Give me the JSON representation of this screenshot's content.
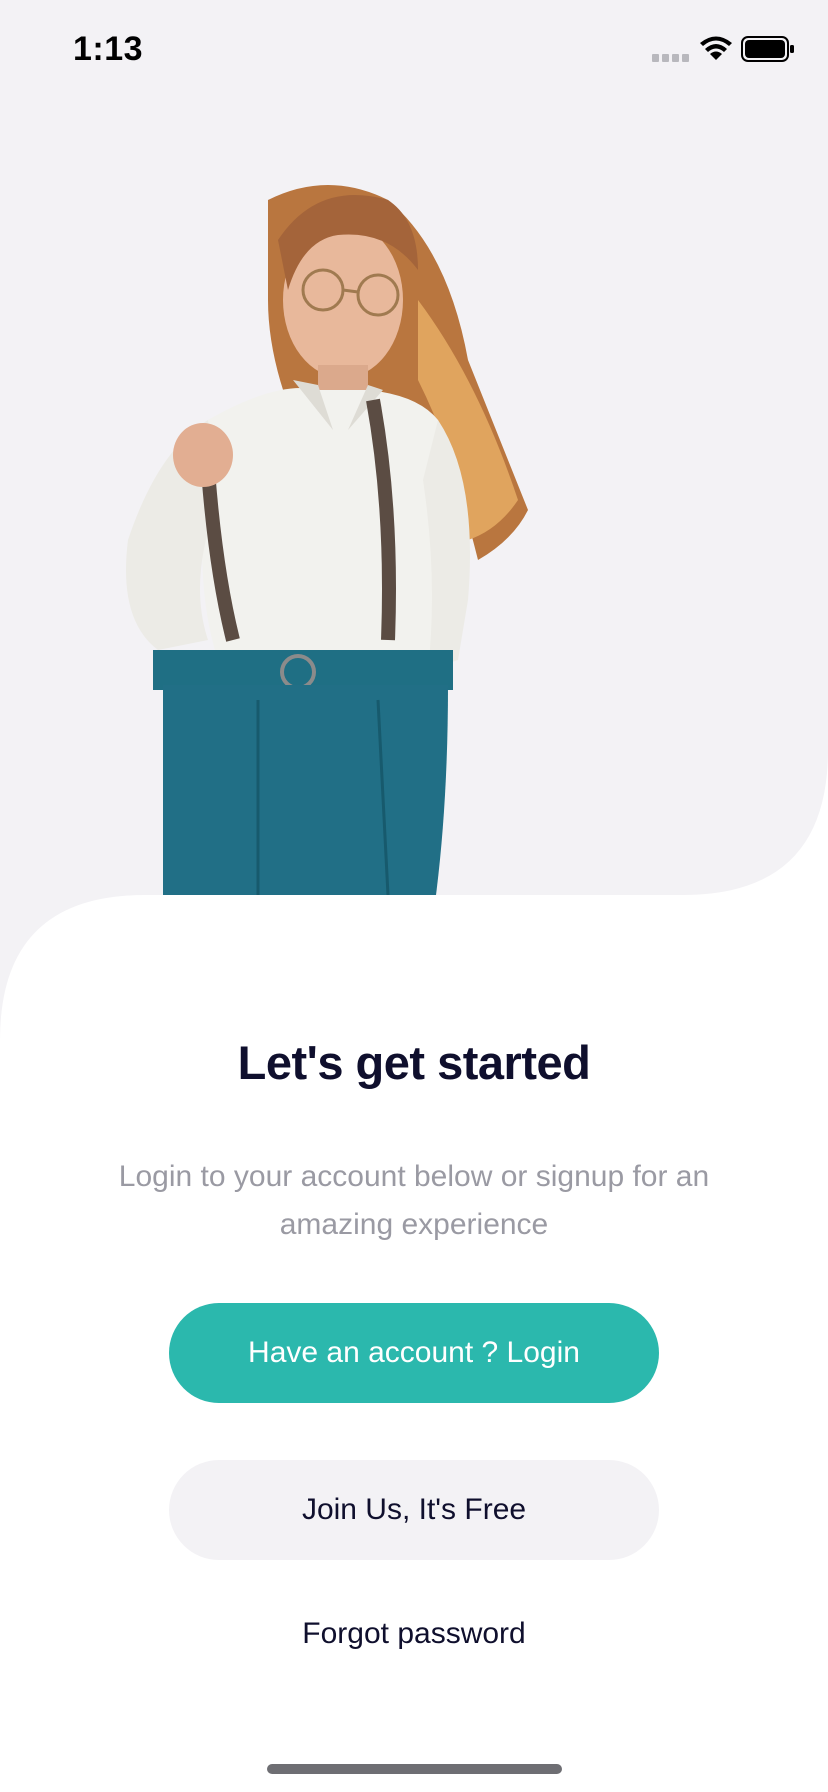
{
  "status_bar": {
    "time": "1:13",
    "icons": [
      "signal-icon",
      "wifi-icon",
      "battery-icon"
    ]
  },
  "hero": {
    "image": "woman-portrait-illustration"
  },
  "onboarding": {
    "title": "Let's get started",
    "subtitle": "Login to your account below or signup for an amazing experience",
    "login_button": "Have an account ? Login",
    "join_button": "Join Us, It's Free",
    "forgot_link": "Forgot password"
  },
  "colors": {
    "accent": "#2bb8ad",
    "title": "#0f0f2d",
    "subtitle": "#9a9aa3",
    "background": "#f3f2f5",
    "card": "#ffffff"
  }
}
